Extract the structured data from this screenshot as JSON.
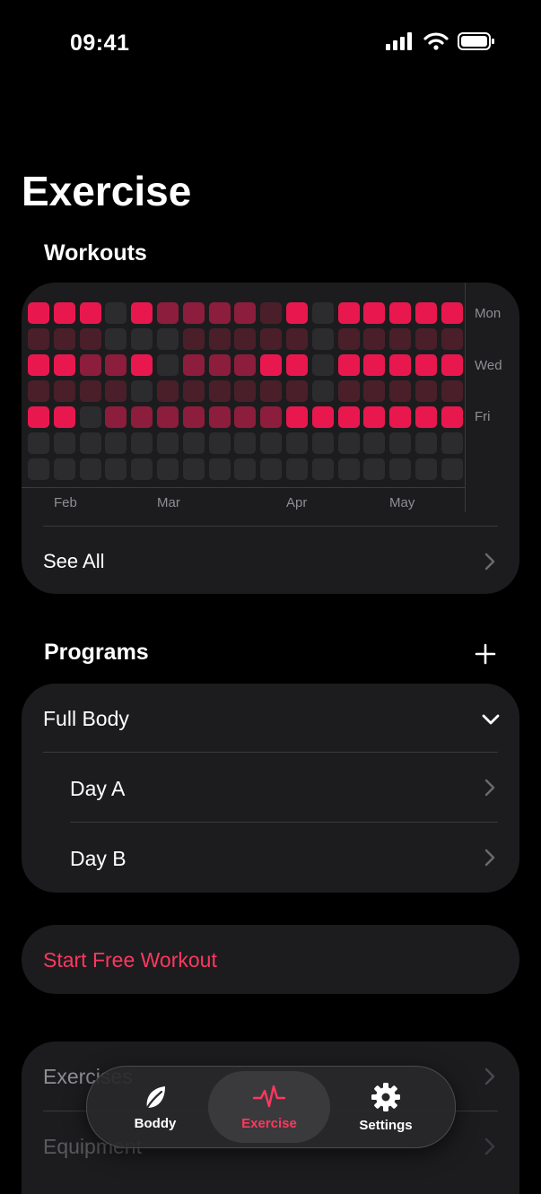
{
  "status": {
    "time": "09:41"
  },
  "page_title": "Exercise",
  "workouts": {
    "title": "Workouts",
    "days": [
      "Mon",
      "Wed",
      "Fri"
    ],
    "months": [
      "Feb",
      "Mar",
      "Apr",
      "May"
    ],
    "see_all": "See All",
    "levels": [
      [
        3,
        3,
        3,
        0,
        3,
        2,
        2,
        2,
        2,
        1,
        3,
        0,
        3,
        3,
        3,
        3,
        3
      ],
      [
        1,
        1,
        1,
        0,
        0,
        0,
        1,
        1,
        1,
        1,
        1,
        0,
        1,
        1,
        1,
        1,
        1
      ],
      [
        3,
        3,
        2,
        2,
        3,
        0,
        2,
        2,
        2,
        3,
        3,
        0,
        3,
        3,
        3,
        3,
        3
      ],
      [
        1,
        1,
        1,
        1,
        0,
        1,
        1,
        1,
        1,
        1,
        1,
        0,
        1,
        1,
        1,
        1,
        1
      ],
      [
        3,
        3,
        0,
        2,
        2,
        2,
        2,
        2,
        2,
        2,
        3,
        3,
        3,
        3,
        3,
        3,
        3
      ],
      [
        0,
        0,
        0,
        0,
        0,
        0,
        0,
        0,
        0,
        0,
        0,
        0,
        0,
        0,
        0,
        0,
        0
      ],
      [
        0,
        0,
        0,
        0,
        0,
        0,
        0,
        0,
        0,
        0,
        0,
        0,
        0,
        0,
        0,
        0,
        0
      ]
    ],
    "colors": [
      "#2c2c2e",
      "#4a1f2a",
      "#8c1d3c",
      "#e8184f"
    ]
  },
  "programs": {
    "title": "Programs",
    "group": "Full Body",
    "items": [
      "Day A",
      "Day B"
    ]
  },
  "start_free_workout": "Start Free Workout",
  "library": {
    "items": [
      "Exercises",
      "Equipment"
    ]
  },
  "tabbar": {
    "tabs": [
      {
        "label": "Boddy",
        "icon": "leaf-icon"
      },
      {
        "label": "Exercise",
        "icon": "heartbeat-icon"
      },
      {
        "label": "Settings",
        "icon": "gear-icon"
      }
    ],
    "accent": "#ff375f"
  }
}
